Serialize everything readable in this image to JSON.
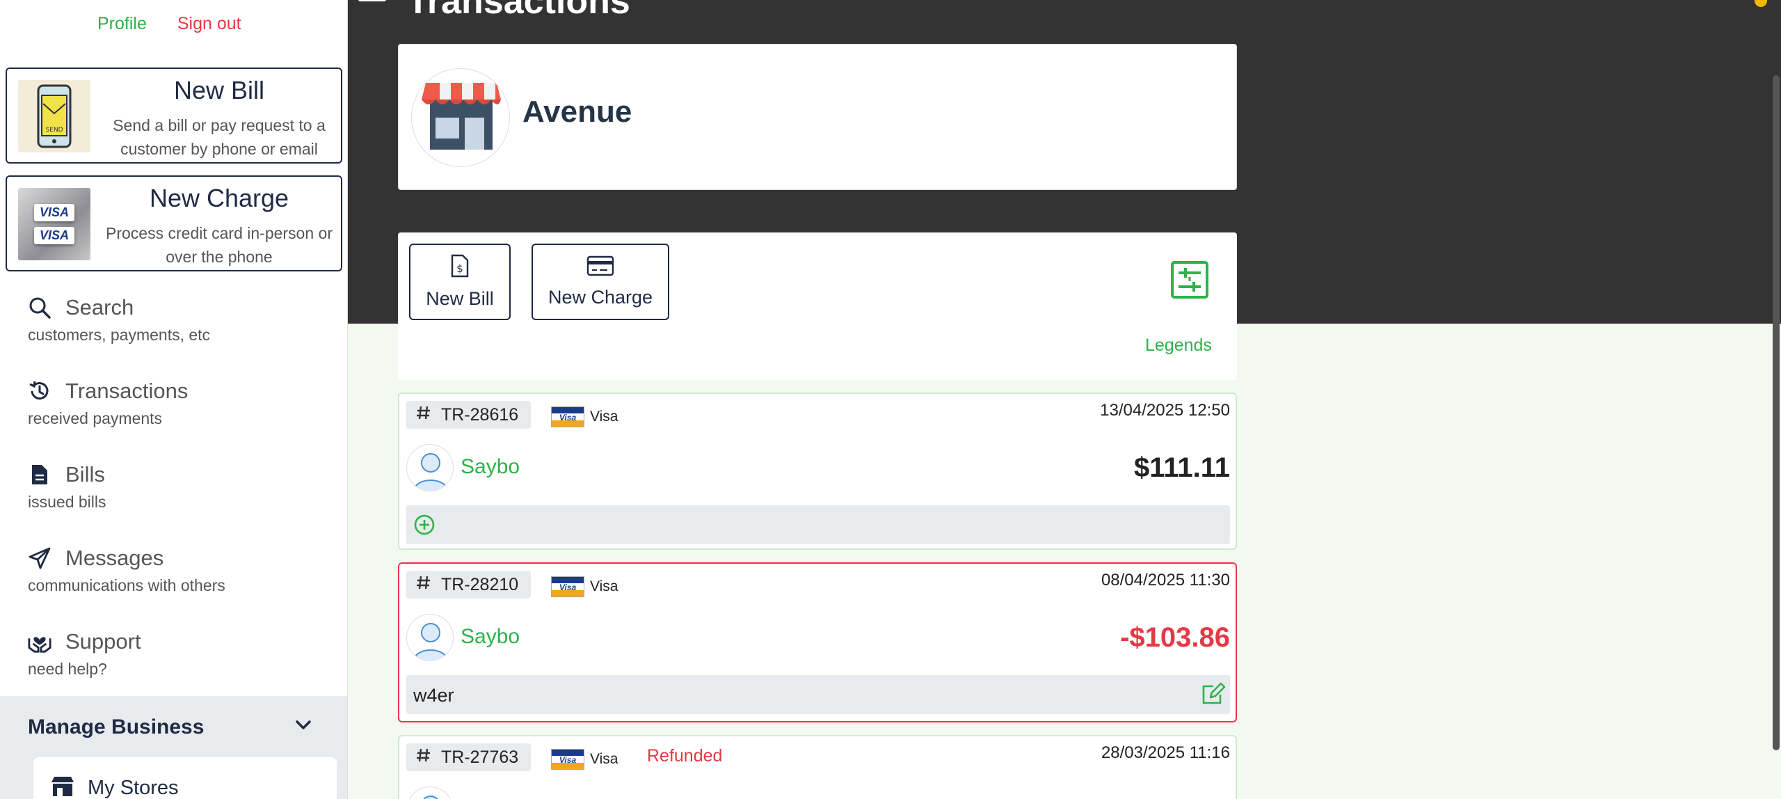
{
  "header": {
    "title": "Transactions"
  },
  "sidebar": {
    "profile": "Profile",
    "sign_out": "Sign out",
    "new_bill": {
      "title": "New Bill",
      "desc": "Send a bill or pay request to a customer by phone or email",
      "thumb_label": "SEND"
    },
    "new_charge": {
      "title": "New Charge",
      "desc": "Process credit card in-person or over the phone",
      "thumb_label": "VISA"
    },
    "nav": [
      {
        "label": "Search",
        "sub": "customers, payments, etc",
        "icon": "search-icon"
      },
      {
        "label": "Transactions",
        "sub": "received payments",
        "icon": "history-icon"
      },
      {
        "label": "Bills",
        "sub": "issued bills",
        "icon": "document-icon"
      },
      {
        "label": "Messages",
        "sub": "communications with others",
        "icon": "paper-plane-icon"
      },
      {
        "label": "Support",
        "sub": "need help?",
        "icon": "support-hands-icon"
      }
    ],
    "manage": {
      "title": "Manage Business",
      "my_stores": "My Stores"
    }
  },
  "store": {
    "name": "Avenue",
    "icon": "storefront-icon"
  },
  "actions": {
    "new_bill": "New Bill",
    "new_charge": "New Charge",
    "legends": "Legends"
  },
  "transactions": [
    {
      "id": "TR-28616",
      "brand": "Visa",
      "date": "13/04/2025 12:50",
      "customer": "Saybo",
      "amount": "$111.11",
      "status": "",
      "note": ""
    },
    {
      "id": "TR-28210",
      "brand": "Visa",
      "date": "08/04/2025 11:30",
      "customer": "Saybo",
      "amount": "-$103.86",
      "status": "",
      "note": "w4er"
    },
    {
      "id": "TR-27763",
      "brand": "Visa",
      "date": "28/03/2025 11:16",
      "customer": "",
      "amount": "",
      "status": "Refunded",
      "note": ""
    }
  ],
  "colors": {
    "accent_green": "#2db24a",
    "danger_red": "#e53945",
    "navy": "#1f2a44",
    "header_dark": "#333333",
    "page_bg": "#f3f9f1"
  }
}
